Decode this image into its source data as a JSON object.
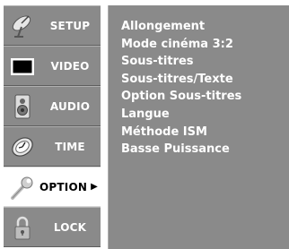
{
  "sidebar": {
    "items": [
      {
        "label": "SETUP",
        "icon": "satellite-dish-icon"
      },
      {
        "label": "VIDEO",
        "icon": "tv-screen-icon"
      },
      {
        "label": "AUDIO",
        "icon": "speaker-icon"
      },
      {
        "label": "TIME",
        "icon": "clock-icon"
      },
      {
        "label": "OPTION",
        "icon": "wrench-icon",
        "arrow": "▶",
        "selected": true
      },
      {
        "label": "LOCK",
        "icon": "padlock-icon"
      }
    ]
  },
  "options_menu": {
    "items": [
      "Allongement",
      "Mode cinéma 3:2",
      "Sous-titres",
      "Sous-titres/Texte",
      "Option Sous-titres",
      "Langue",
      "Méthode ISM",
      "Basse Puissance"
    ]
  },
  "colors": {
    "panel": "#8a8a8a",
    "selected": "#ffffff",
    "text": "#ffffff"
  }
}
